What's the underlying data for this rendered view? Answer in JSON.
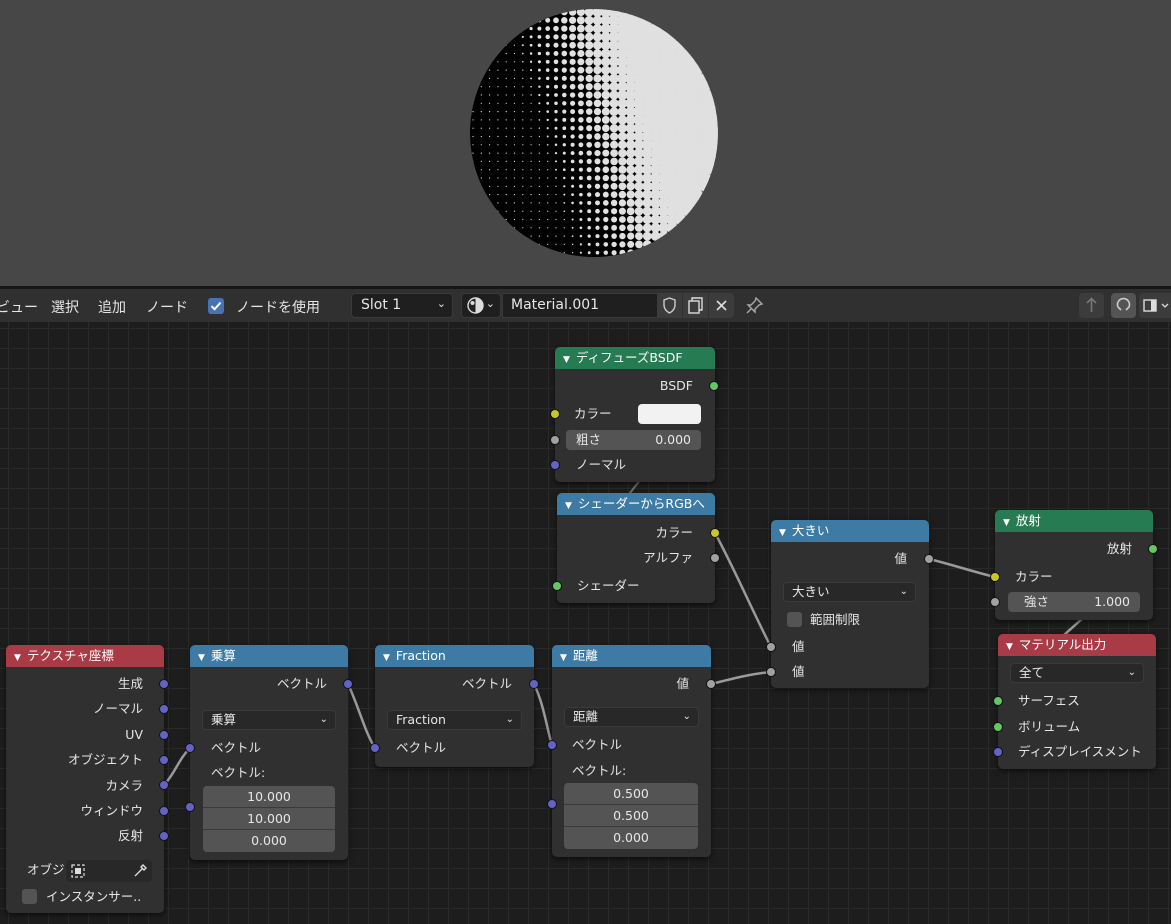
{
  "header": {
    "menu_view": "ビュー",
    "menu_select": "選択",
    "menu_add": "追加",
    "menu_node": "ノード",
    "use_nodes_label": "ノードを使用",
    "slot": "Slot 1",
    "material_name": "Material.001"
  },
  "nodes": {
    "diffuse": {
      "title": "ディフューズBSDF",
      "out_bsdf": "BSDF",
      "in_color": "カラー",
      "in_rough_label": "粗さ",
      "in_rough_value": "0.000",
      "in_normal": "ノーマル"
    },
    "shader_to_rgb": {
      "title": "シェーダーからRGBへ",
      "out_color": "カラー",
      "out_alpha": "アルファ",
      "in_shader": "シェーダー"
    },
    "greater": {
      "title": "大きい",
      "out_value": "値",
      "mode": "大きい",
      "clamp_label": "範囲制限",
      "in_value1": "値",
      "in_value2": "値"
    },
    "emission": {
      "title": "放射",
      "out_emission": "放射",
      "in_color": "カラー",
      "in_strength_label": "強さ",
      "in_strength_value": "1.000"
    },
    "material_output": {
      "title": "マテリアル出力",
      "target": "全て",
      "in_surface": "サーフェス",
      "in_volume": "ボリューム",
      "in_displacement": "ディスプレイスメント"
    },
    "tex_coord": {
      "title": "テクスチャ座標",
      "out_generated": "生成",
      "out_normal": "ノーマル",
      "out_uv": "UV",
      "out_object": "オブジェクト",
      "out_camera": "カメラ",
      "out_window": "ウィンドウ",
      "out_reflection": "反射",
      "object_label": "オブジ",
      "instancer_label": "インスタンサー.."
    },
    "multiply": {
      "title": "乗算",
      "out_vector": "ベクトル",
      "mode": "乗算",
      "in_vector1": "ベクトル",
      "in_vector2_label": "ベクトル:",
      "values": [
        "10.000",
        "10.000",
        "0.000"
      ]
    },
    "fraction": {
      "title": "Fraction",
      "out_vector": "ベクトル",
      "mode": "Fraction",
      "in_vector": "ベクトル"
    },
    "distance": {
      "title": "距離",
      "out_value": "値",
      "mode": "距離",
      "in_vector1": "ベクトル",
      "in_vector2_label": "ベクトル:",
      "values": [
        "0.500",
        "0.500",
        "0.000"
      ]
    }
  },
  "colors": {
    "green_header": "#277b52",
    "blue_header": "#3d7ba5",
    "red_header": "#a83b45",
    "accent": "#4772b3"
  },
  "icons": [
    "checkbox-checked-icon",
    "material-sphere-icon",
    "shield-icon",
    "duplicate-icon",
    "close-icon",
    "pin-icon",
    "parent-arrow-icon",
    "snap-icon",
    "sidebar-icon",
    "eyedropper-icon",
    "object-icon"
  ]
}
